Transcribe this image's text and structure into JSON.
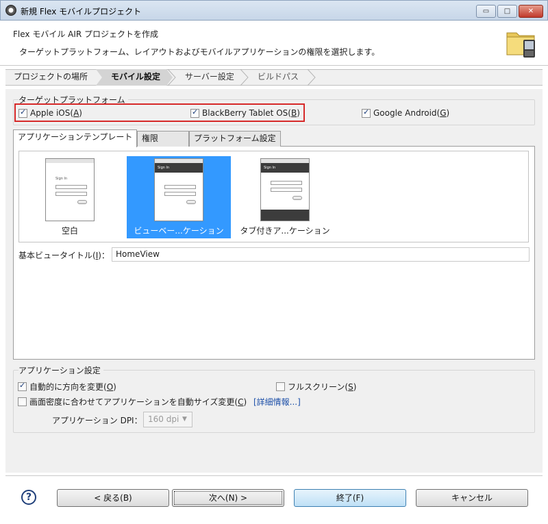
{
  "window": {
    "title": "新規 Flex モバイルプロジェクト",
    "min_glyph": "▭",
    "max_glyph": "□",
    "close_glyph": "✕"
  },
  "header": {
    "title": "Flex モバイル AIR プロジェクトを作成",
    "description": "ターゲットプラットフォーム、レイアウトおよびモバイルアプリケーションの権限を選択します。",
    "icon": "folder-phone-icon"
  },
  "steps": [
    {
      "label": "プロジェクトの場所",
      "active": false
    },
    {
      "label": "モバイル設定",
      "active": true
    },
    {
      "label": "サーバー設定",
      "active": false
    },
    {
      "label": "ビルドパス",
      "active": false
    }
  ],
  "target_platforms": {
    "label": "ターゲットプラットフォーム",
    "options": [
      {
        "label": "Apple iOS(",
        "mnemonic": "A",
        "suffix": ")",
        "checked": true
      },
      {
        "label": "BlackBerry Tablet OS(",
        "mnemonic": "B",
        "suffix": ")",
        "checked": true
      },
      {
        "label": "Google Android(",
        "mnemonic": "G",
        "suffix": ")",
        "checked": true
      }
    ]
  },
  "tabs": [
    {
      "label": "アプリケーションテンプレート",
      "selected": true
    },
    {
      "label": "権限",
      "selected": false
    },
    {
      "label": "プラットフォーム設定",
      "selected": false
    }
  ],
  "templates": [
    {
      "caption": "空白",
      "selected": false,
      "screen_title": "Sign In"
    },
    {
      "caption": "ビューベー...ケーション",
      "selected": true,
      "screen_title": "Sign In"
    },
    {
      "caption": "タブ付きア...ケーション",
      "selected": false,
      "screen_title": "Sign In"
    }
  ],
  "view_title": {
    "label": "基本ビュータイトル(",
    "mnemonic": "I",
    "suffix": ")：",
    "value": "HomeView"
  },
  "app_settings": {
    "label": "アプリケーション設定",
    "orientation": {
      "label": "自動的に方向を変更(",
      "mnemonic": "O",
      "suffix": ")",
      "checked": true
    },
    "fullscreen": {
      "label": "フルスクリーン(",
      "mnemonic": "S",
      "suffix": ")",
      "checked": false
    },
    "auto_resize": {
      "label": "画面密度に合わせてアプリケーションを自動サイズ変更(",
      "mnemonic": "C",
      "suffix": ")",
      "checked": false
    },
    "details_link": "[詳細情報...]",
    "dpi_label": "アプリケーション DPI：",
    "dpi_value": "160 dpi"
  },
  "buttons": {
    "back": "< 戻る(B)",
    "next": "次へ(N) >",
    "finish": "終了(F)",
    "cancel": "キャンセル"
  },
  "colors": {
    "selection": "#3399ff",
    "highlight_border": "#d62828",
    "link": "#1c4fa8"
  }
}
